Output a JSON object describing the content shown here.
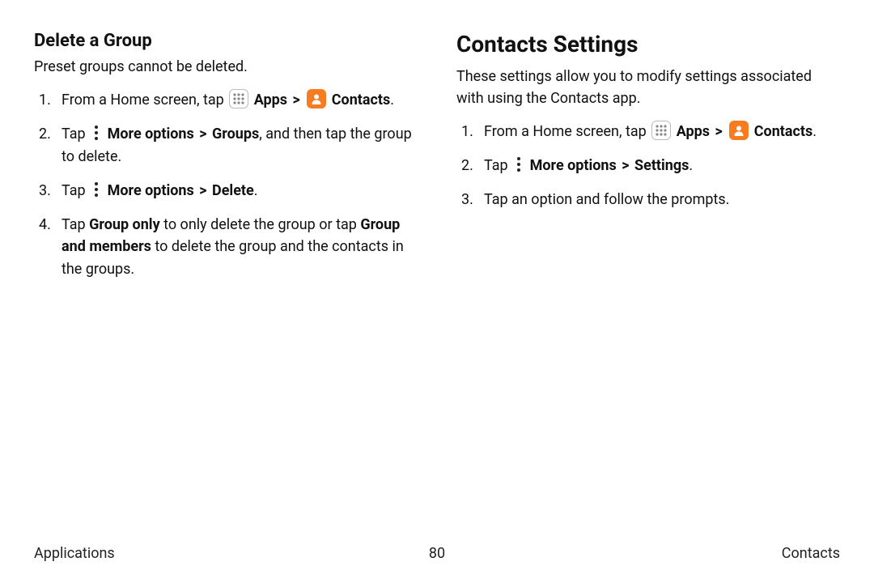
{
  "left": {
    "heading": "Delete a Group",
    "intro": "Preset groups cannot be deleted.",
    "step1_pre": "From a Home screen, tap ",
    "apps_label": "Apps",
    "chevron": ">",
    "contacts_label": "Contacts",
    "period": ".",
    "step2_pre": "Tap ",
    "step2_more": "More options",
    "step2_groups": "Groups",
    "step2_post": ", and then tap the group to delete.",
    "step3_pre": "Tap ",
    "step3_more": "More options",
    "step3_delete": "Delete",
    "step4_pre": "Tap ",
    "step4_grouponly": "Group only",
    "step4_mid": " to only delete the group or tap ",
    "step4_groupmembers": "Group and members",
    "step4_post": " to delete the group and the contacts in the groups."
  },
  "right": {
    "heading": "Contacts Settings",
    "intro": "These settings allow you to modify settings associated with using the Contacts app.",
    "step1_pre": "From a Home screen, tap ",
    "apps_label": "Apps",
    "chevron": ">",
    "contacts_label": "Contacts",
    "period": ".",
    "step2_pre": "Tap ",
    "step2_more": "More options",
    "step2_settings": "Settings",
    "step3": "Tap an option and follow the prompts."
  },
  "footer": {
    "left": "Applications",
    "center": "80",
    "right": "Contacts"
  }
}
